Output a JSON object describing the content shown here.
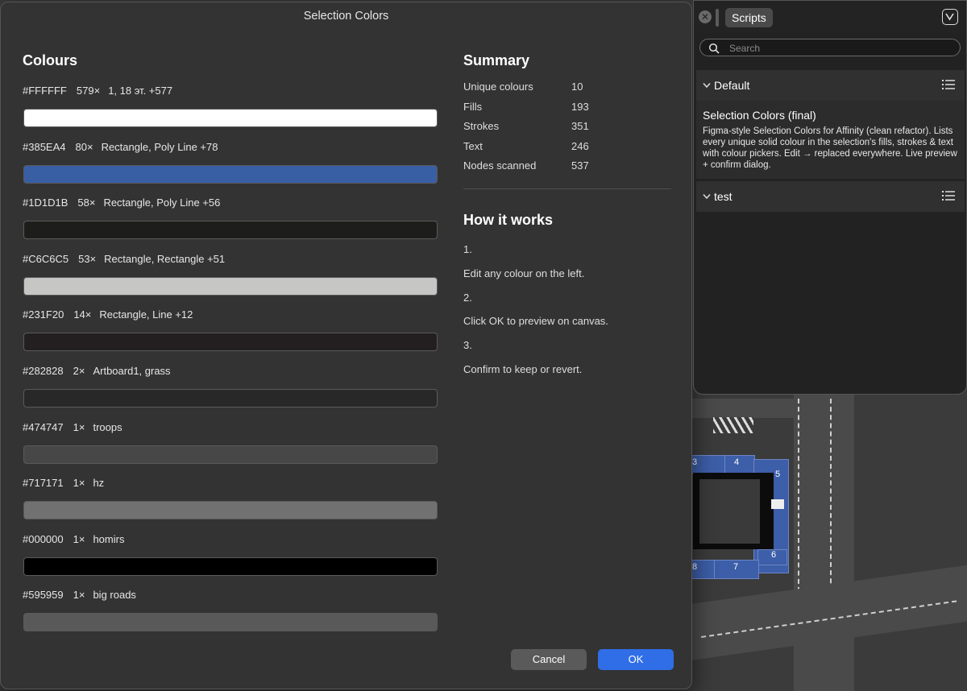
{
  "dialog": {
    "title": "Selection Colors",
    "colours_heading": "Colours",
    "swatches": [
      {
        "hex": "#FFFFFF",
        "count": "579×",
        "nodes": "1, 18 эт. +577"
      },
      {
        "hex": "#385EA4",
        "count": "80×",
        "nodes": "Rectangle, Poly Line +78"
      },
      {
        "hex": "#1D1D1B",
        "count": "58×",
        "nodes": "Rectangle, Poly Line +56"
      },
      {
        "hex": "#C6C6C5",
        "count": "53×",
        "nodes": "Rectangle, Rectangle +51"
      },
      {
        "hex": "#231F20",
        "count": "14×",
        "nodes": "Rectangle, Line +12"
      },
      {
        "hex": "#282828",
        "count": "2×",
        "nodes": "Artboard1, grass"
      },
      {
        "hex": "#474747",
        "count": "1×",
        "nodes": "troops"
      },
      {
        "hex": "#717171",
        "count": "1×",
        "nodes": "hz"
      },
      {
        "hex": "#000000",
        "count": "1×",
        "nodes": "homirs"
      },
      {
        "hex": "#595959",
        "count": "1×",
        "nodes": "big roads"
      }
    ],
    "summary_heading": "Summary",
    "summary": [
      {
        "label": "Unique colours",
        "value": "10"
      },
      {
        "label": "Fills",
        "value": "193"
      },
      {
        "label": "Strokes",
        "value": "351"
      },
      {
        "label": "Text",
        "value": "246"
      },
      {
        "label": "Nodes scanned",
        "value": "537"
      }
    ],
    "how_heading": "How it works",
    "steps": [
      "1.",
      "Edit any colour on the left.",
      "2.",
      "Click OK to preview on canvas.",
      "3.",
      "Confirm to keep or revert."
    ],
    "cancel_label": "Cancel",
    "ok_label": "OK",
    "ok_color": "#2f6ee6"
  },
  "scripts_panel": {
    "tab_label": "Scripts",
    "search_placeholder": "Search",
    "groups": [
      {
        "name": "Default"
      },
      {
        "name": "test"
      }
    ],
    "script": {
      "name": "Selection Colors (final)",
      "description": "Figma-style Selection Colors for Affinity (clean refactor). Lists every unique solid colour in the selection's fills, strokes & text with colour pickers. Edit → replaced everywhere. Live preview + confirm dialog."
    }
  },
  "canvas": {
    "building_labels": [
      "3",
      "4",
      "5",
      "6",
      "7",
      "8"
    ]
  }
}
